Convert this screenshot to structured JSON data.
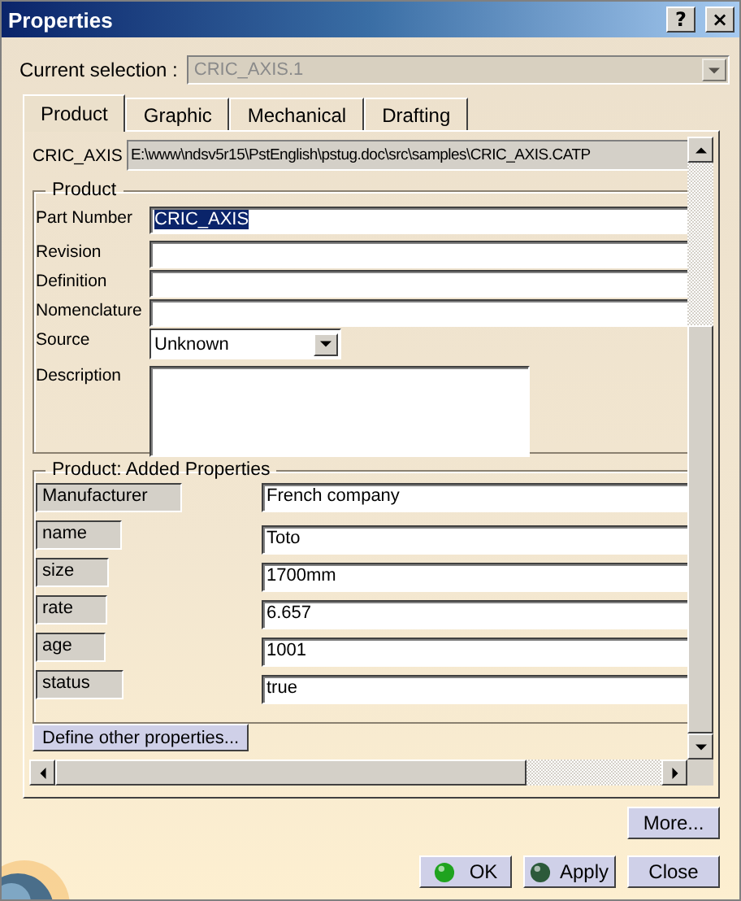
{
  "window": {
    "title": "Properties",
    "controls": [
      {
        "kind": "help",
        "label": "?"
      },
      {
        "kind": "close",
        "label": "×"
      }
    ]
  },
  "current_selection": {
    "label": "Current selection :",
    "value": "CRIC_AXIS.1",
    "disabled": true
  },
  "tabs": [
    {
      "label": "Product",
      "selected": true
    },
    {
      "label": "Graphic",
      "selected": false
    },
    {
      "label": "Mechanical",
      "selected": false
    },
    {
      "label": "Drafting",
      "selected": false
    }
  ],
  "path": {
    "label": "CRIC_AXIS",
    "value": "E:\\www\\ndsv5r15\\PstEnglish\\pstug.doc\\src\\samples\\CRIC_AXIS.CATP"
  },
  "product": {
    "title": "Product",
    "fields": [
      {
        "kind": "text",
        "label": "Part Number",
        "value": "CRIC_AXIS",
        "text_selected": true
      },
      {
        "kind": "text",
        "label": "Revision"
      },
      {
        "kind": "text",
        "label": "Definition"
      },
      {
        "kind": "text",
        "label": "Nomenclature"
      },
      {
        "kind": "select",
        "label": "Source",
        "value": "Unknown"
      },
      {
        "kind": "textarea",
        "label": "Description"
      }
    ]
  },
  "added_properties": {
    "title": "Product: Added Properties",
    "rows": [
      {
        "name": "Manufacturer",
        "value": "French company"
      },
      {
        "name": "name",
        "value": "Toto"
      },
      {
        "name": "size",
        "value": "1700mm"
      },
      {
        "name": "rate",
        "value": "6.657"
      },
      {
        "name": "age",
        "value": "1001"
      },
      {
        "name": "status",
        "value": "true"
      }
    ]
  },
  "define_button": "Define other properties...",
  "buttons": [
    {
      "kind": "plain",
      "label": "More..."
    },
    {
      "kind": "ok",
      "label": "OK"
    },
    {
      "kind": "apply",
      "label": "Apply"
    },
    {
      "kind": "plain",
      "label": "Close"
    }
  ]
}
